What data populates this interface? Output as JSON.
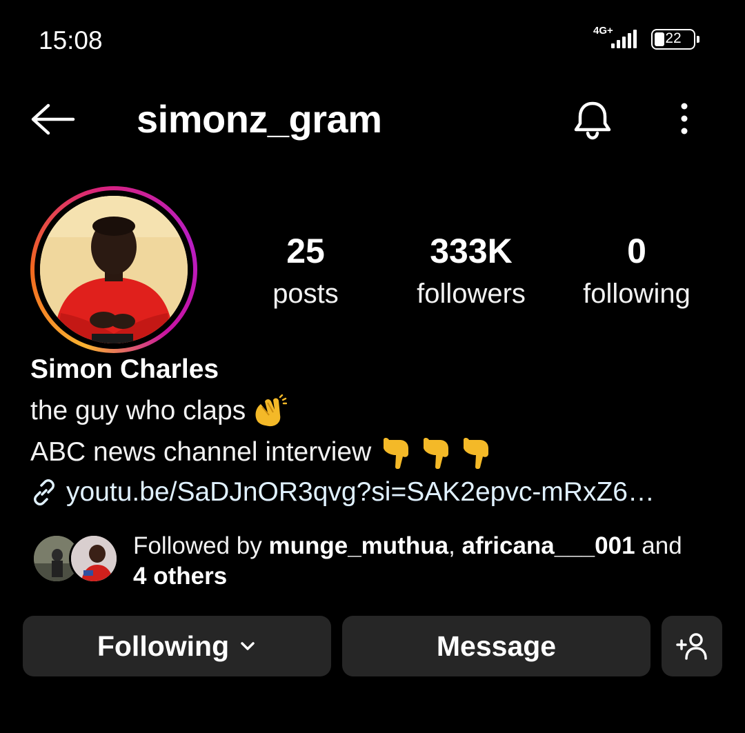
{
  "status_bar": {
    "time": "15:08",
    "network": "4G+",
    "battery": "22"
  },
  "header": {
    "username": "simonz_gram",
    "back_icon": "arrow-left-icon",
    "bell_icon": "bell-icon",
    "more_icon": "more-vertical-icon"
  },
  "stats": {
    "posts_count": "25",
    "posts_label": "posts",
    "followers_count": "333K",
    "followers_label": "followers",
    "following_count": "0",
    "following_label": "following"
  },
  "bio": {
    "full_name": "Simon Charles",
    "line1": "the guy who claps",
    "line1_emoji": "clapping-hands",
    "line2": "ABC news channel interview",
    "line2_emoji": "pointing-down x3",
    "link": "youtu.be/SaDJnOR3qvg?si=SAK2epvc-mRxZ6…"
  },
  "followed_by": {
    "prefix": "Followed by ",
    "user1": "munge_muthua",
    "separator": ", ",
    "user2": "africana___001",
    "connector": " and",
    "others": "4 others"
  },
  "actions": {
    "following_label": "Following",
    "message_label": "Message",
    "add_user_icon": "add-person-icon"
  },
  "colors": {
    "background": "#000000",
    "button_bg": "#262626",
    "link": "#e0f1ff",
    "ring_start": "#f9b331",
    "ring_end": "#c813a1"
  }
}
